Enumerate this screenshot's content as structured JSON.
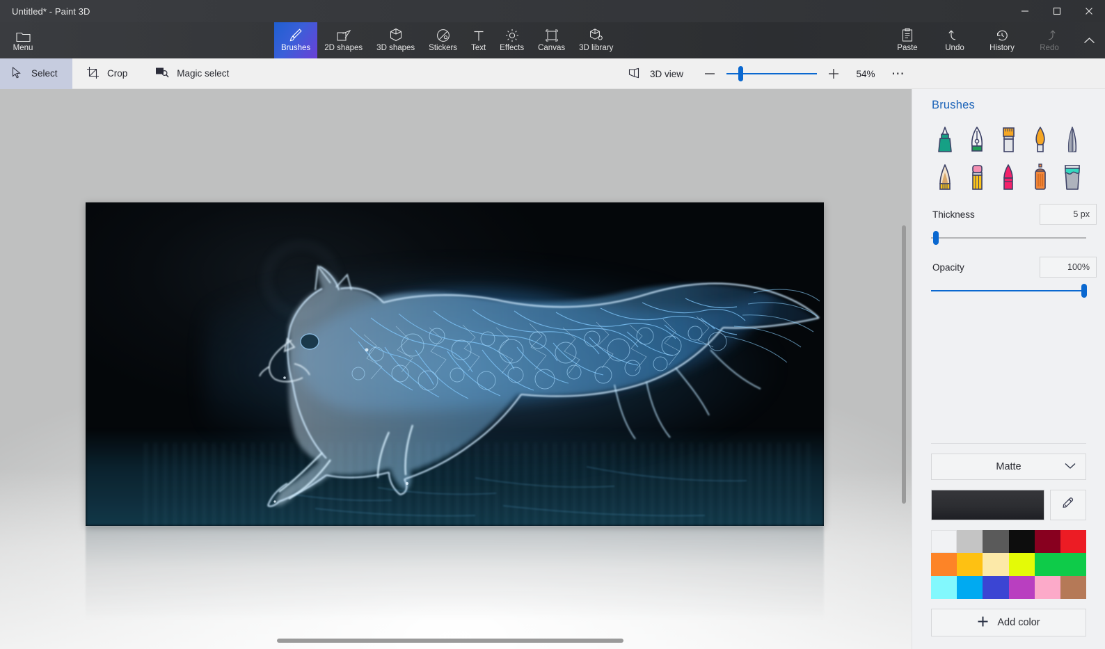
{
  "window": {
    "title": "Untitled* - Paint 3D",
    "controls": [
      {
        "name": "minimize",
        "glyph": "minimize-icon"
      },
      {
        "name": "maximize",
        "glyph": "maximize-icon"
      },
      {
        "name": "close",
        "glyph": "close-icon"
      }
    ]
  },
  "ribbon": {
    "menu": {
      "label": "Menu",
      "icon": "folder-icon"
    },
    "tools": [
      {
        "label": "Brushes",
        "icon": "brush-icon",
        "active": true
      },
      {
        "label": "2D shapes",
        "icon": "2d-shapes-icon",
        "active": false
      },
      {
        "label": "3D shapes",
        "icon": "3d-shapes-icon",
        "active": false
      },
      {
        "label": "Stickers",
        "icon": "stickers-icon",
        "active": false
      },
      {
        "label": "Text",
        "icon": "text-icon",
        "active": false
      },
      {
        "label": "Effects",
        "icon": "effects-icon",
        "active": false
      },
      {
        "label": "Canvas",
        "icon": "canvas-icon",
        "active": false
      },
      {
        "label": "3D library",
        "icon": "3d-library-icon",
        "active": false
      }
    ],
    "actions": [
      {
        "label": "Paste",
        "icon": "paste-icon",
        "disabled": false
      },
      {
        "label": "Undo",
        "icon": "undo-icon",
        "disabled": false
      },
      {
        "label": "History",
        "icon": "history-icon",
        "disabled": false
      },
      {
        "label": "Redo",
        "icon": "redo-icon",
        "disabled": true
      }
    ],
    "collapse_icon": "chevron-up-icon"
  },
  "subbar": {
    "select": {
      "label": "Select",
      "icon": "cursor-icon",
      "selected": true
    },
    "crop": {
      "label": "Crop",
      "icon": "crop-icon"
    },
    "magic_select": {
      "label": "Magic select",
      "icon": "magic-select-icon"
    },
    "view_3d": {
      "label": "3D view",
      "icon": "3d-view-icon"
    },
    "zoom_out_icon": "minus-icon",
    "zoom_in_icon": "plus-icon",
    "zoom_value": "54%",
    "zoom_slider_percent": 16,
    "more_icon": "ellipsis-icon"
  },
  "panel": {
    "title": "Brushes",
    "brushes": [
      {
        "name": "marker-brush"
      },
      {
        "name": "calligraphy-pen-brush"
      },
      {
        "name": "oil-brush"
      },
      {
        "name": "watercolor-brush"
      },
      {
        "name": "pixel-pen-brush"
      },
      {
        "name": "pencil-brush"
      },
      {
        "name": "eraser-brush"
      },
      {
        "name": "crayon-brush"
      },
      {
        "name": "spray-can-brush"
      },
      {
        "name": "fill-bucket-brush"
      }
    ],
    "thickness": {
      "label": "Thickness",
      "value": "5 px",
      "slider_percent": 3
    },
    "opacity": {
      "label": "Opacity",
      "value": "100%",
      "slider_percent": 100
    },
    "material": {
      "value": "Matte",
      "chevron": "chevron-down-icon"
    },
    "current_color": "#2c2d31",
    "eyedropper_icon": "eyedropper-icon",
    "palette": [
      "#f1f2f4",
      "#c4c4c4",
      "#5a5a5a",
      "#0d0d0d",
      "#88001f",
      "#ec1c24",
      "#fd8427",
      "#fec112",
      "#fce9a8",
      "#e4fa07",
      "#0ecb49",
      "#0ecb49",
      "#82f8fd",
      "#00aaf1",
      "#3b45d3",
      "#b93fc0",
      "#fcaac9",
      "#b57957"
    ],
    "add_color": {
      "label": "Add color",
      "icon": "plus-icon"
    }
  },
  "canvas": {
    "artwork_name": "glowing-blue-cheetah-artwork",
    "vertical_scrollbar": true,
    "horizontal_scrollbar": true
  }
}
